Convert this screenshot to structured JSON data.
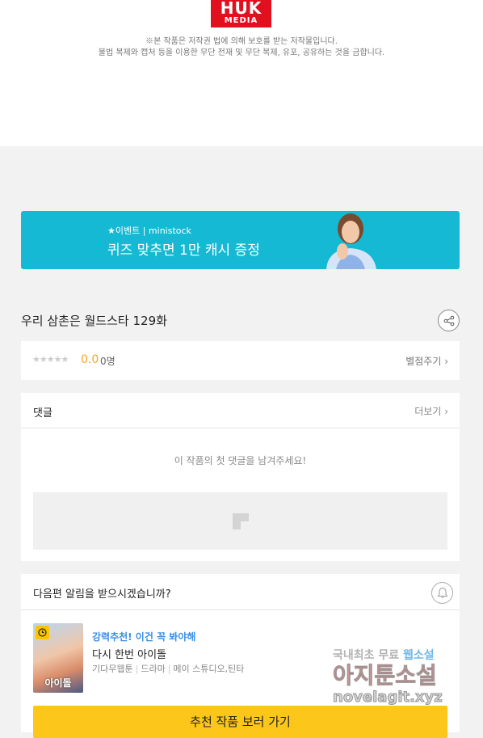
{
  "header": {
    "logo_top": "HUK",
    "logo_bottom": "MEDIA",
    "notice_line1": "※본 작품은 저작권 법에 의해 보호를 받는 저작물입니다.",
    "notice_line2": "불법 복제와 캡처 등을 이용한 무단 전재 및 무단 복제, 유포, 공유하는 것을 금합니다."
  },
  "banner": {
    "small": "★이벤트 | ministock",
    "big": "퀴즈 맞추면 1만 캐시 증정",
    "bg_color": "#16b9d3"
  },
  "episode": {
    "title": "우리 삼촌은 월드스타 129화",
    "share_icon": "share-icon"
  },
  "rating": {
    "stars": "★★★★★",
    "score": "0.0",
    "count": "0명",
    "rate_link": "별점주기 ›"
  },
  "comments": {
    "title": "댓글",
    "more": "더보기 ›",
    "empty": "이 작품의 첫 댓글을 남겨주세요!"
  },
  "alert": {
    "question": "다음편 알림을 받으시겠습니까?",
    "bell_icon": "bell-icon"
  },
  "recommend": {
    "tag": "강력추천! 이건 꼭 봐야해",
    "name": "다시 한번 아이돌",
    "thumb_text": "아이돌",
    "meta": [
      "기다무웹툰",
      "드라마",
      "메이 스튜디오,틴타"
    ],
    "button": "추천 작품 보러 가기",
    "accent": "#fdc61b"
  },
  "watermark": {
    "line1_a": "국내최초 무료 ",
    "line1_b": "웹소설",
    "line2": "아지툰소설",
    "line3": "novelagit.xyz"
  }
}
